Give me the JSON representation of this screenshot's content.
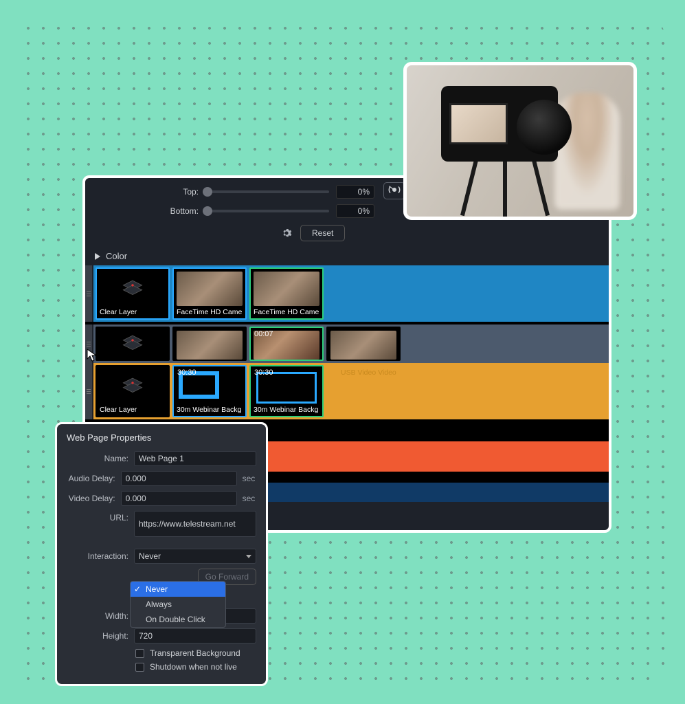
{
  "crop": {
    "top_label": "Top:",
    "bottom_label": "Bottom:",
    "top_value": "0%",
    "bottom_value": "0%",
    "reset_label": "Reset"
  },
  "section": {
    "color_label": "Color"
  },
  "tracks": {
    "row1": [
      {
        "label": "Clear Layer",
        "type": "clear",
        "selected": "blue"
      },
      {
        "label": "FaceTime HD Came",
        "type": "cam",
        "selected": "blue"
      },
      {
        "label": "FaceTime HD Came",
        "type": "cam",
        "selected": "green"
      }
    ],
    "row2": [
      {
        "label": "",
        "type": "clear-small"
      },
      {
        "label": "",
        "type": "cam-small"
      },
      {
        "label": "",
        "type": "cam-small",
        "timecode": "00:07",
        "selected": "green"
      },
      {
        "label": "",
        "type": "cam-small"
      }
    ],
    "row2_overlay_label": "USB Video Video",
    "row3": [
      {
        "label": "Clear Layer",
        "type": "clear"
      },
      {
        "label": "30m Webinar Backg",
        "type": "webinar",
        "timecode": "30:30",
        "selected": "blue"
      },
      {
        "label": "30m Webinar Backg",
        "type": "webinar-dual",
        "timecode": "30:30",
        "selected": "green"
      }
    ]
  },
  "props": {
    "title": "Web Page Properties",
    "name_label": "Name:",
    "name_value": "Web Page 1",
    "audio_delay_label": "Audio Delay:",
    "audio_delay_value": "0.000",
    "video_delay_label": "Video Delay:",
    "video_delay_value": "0.000",
    "delay_unit": "sec",
    "url_label": "URL:",
    "url_value": "https://www.telestream.net",
    "interaction_label": "Interaction:",
    "interaction_value": "Never",
    "interaction_options": [
      "Never",
      "Always",
      "On Double Click"
    ],
    "go_forward_label": "Go Forward",
    "width_label": "Width:",
    "width_value": "",
    "height_label": "Height:",
    "height_value": "720",
    "transparent_label": "Transparent Background",
    "shutdown_label": "Shutdown when not live"
  },
  "colors": {
    "track_blue": "#1f86c4",
    "track_steel": "#4c5a6d",
    "track_orange": "#e6a030",
    "stripe_orange": "#f05a32",
    "stripe_navy": "#103a66"
  }
}
